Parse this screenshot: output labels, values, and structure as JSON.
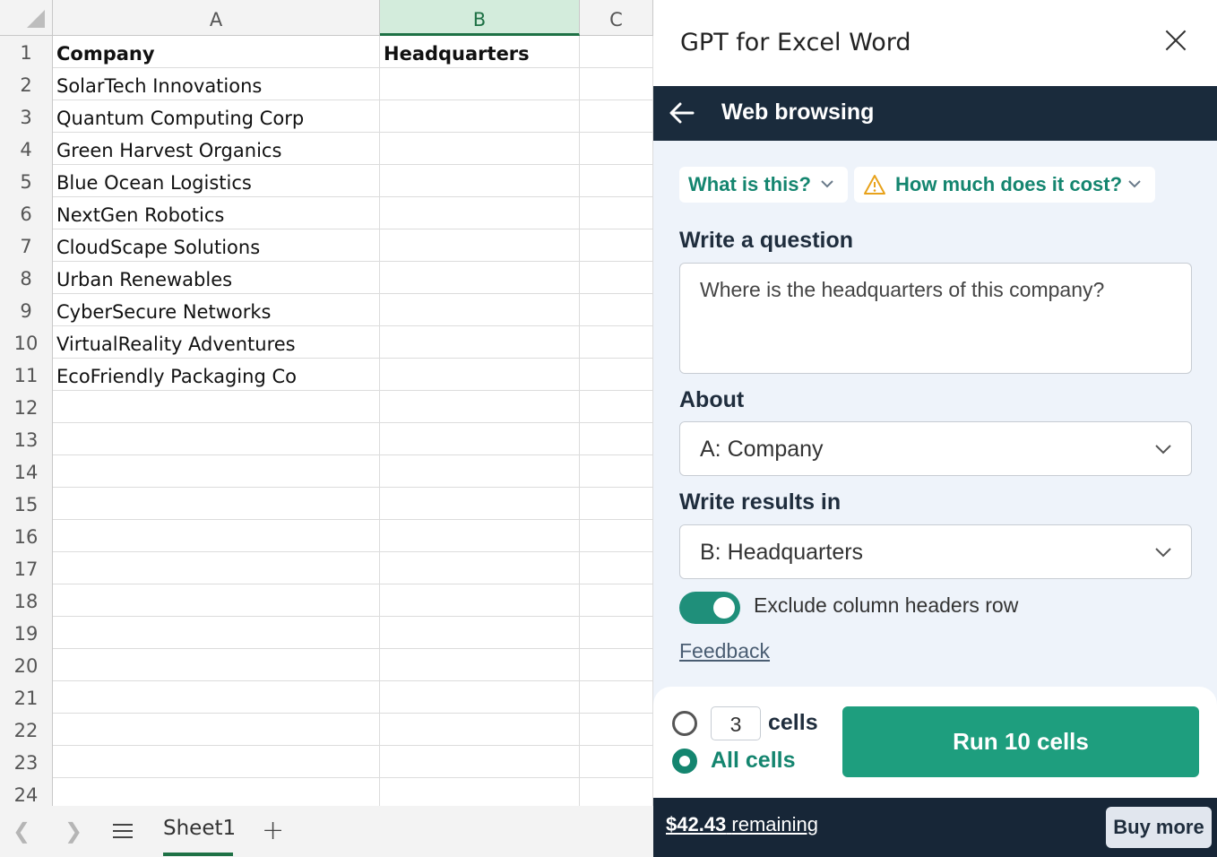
{
  "sheet": {
    "columns": [
      "A",
      "B",
      "C"
    ],
    "rows": [
      {
        "num": "1",
        "a": "Company",
        "b": "Headquarters"
      },
      {
        "num": "2",
        "a": "SolarTech Innovations",
        "b": ""
      },
      {
        "num": "3",
        "a": "Quantum Computing Corp",
        "b": ""
      },
      {
        "num": "4",
        "a": "Green Harvest Organics",
        "b": ""
      },
      {
        "num": "5",
        "a": "Blue Ocean Logistics",
        "b": ""
      },
      {
        "num": "6",
        "a": "NextGen Robotics",
        "b": ""
      },
      {
        "num": "7",
        "a": "CloudScape Solutions",
        "b": ""
      },
      {
        "num": "8",
        "a": "Urban Renewables",
        "b": ""
      },
      {
        "num": "9",
        "a": "CyberSecure Networks",
        "b": ""
      },
      {
        "num": "10",
        "a": "VirtualReality Adventures",
        "b": ""
      },
      {
        "num": "11",
        "a": "EcoFriendly Packaging Co",
        "b": ""
      },
      {
        "num": "12",
        "a": "",
        "b": ""
      },
      {
        "num": "13",
        "a": "",
        "b": ""
      },
      {
        "num": "14",
        "a": "",
        "b": ""
      },
      {
        "num": "15",
        "a": "",
        "b": ""
      },
      {
        "num": "16",
        "a": "",
        "b": ""
      },
      {
        "num": "17",
        "a": "",
        "b": ""
      },
      {
        "num": "18",
        "a": "",
        "b": ""
      },
      {
        "num": "19",
        "a": "",
        "b": ""
      },
      {
        "num": "20",
        "a": "",
        "b": ""
      },
      {
        "num": "21",
        "a": "",
        "b": ""
      },
      {
        "num": "22",
        "a": "",
        "b": ""
      },
      {
        "num": "23",
        "a": "",
        "b": ""
      },
      {
        "num": "24",
        "a": "",
        "b": ""
      }
    ],
    "tab_name": "Sheet1",
    "accent": "#1e7145"
  },
  "panel": {
    "title": "GPT for Excel Word",
    "nav_title": "Web browsing",
    "chips": [
      {
        "label": "What is this?",
        "icon": "chevron-down-icon"
      },
      {
        "label": "How much does it cost?",
        "icon": "warning-icon"
      }
    ],
    "question_label": "Write a question",
    "question_value": "Where is the headquarters of this company?",
    "about_label": "About",
    "about_value": "A: Company",
    "results_label": "Write results in",
    "results_value": "B: Headquarters",
    "toggle_label": "Exclude column headers row",
    "toggle_on": true,
    "feedback_label": "Feedback",
    "cells_count": "3",
    "cells_label": "cells",
    "all_cells_label": "All cells",
    "selected_option": "All cells",
    "run_label": "Run 10 cells",
    "remaining_amount": "$42.43",
    "remaining_label": "remaining",
    "buy_more_label": "Buy more",
    "colors": {
      "accent": "#1e9e7e",
      "nav": "#1a2b3c",
      "warning": "#e8a21b"
    }
  }
}
